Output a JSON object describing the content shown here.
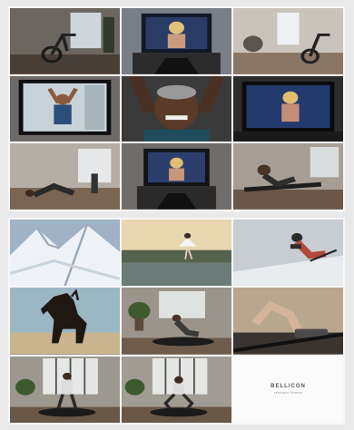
{
  "image_description_free": true,
  "colors": {
    "frame_bg": "#f7f7f7",
    "page_bg": "#e9e9e9"
  },
  "top_board": {
    "tiles": [
      {
        "icon": "bike-in-living-room"
      },
      {
        "icon": "screen-blonde-instructor"
      },
      {
        "icon": "bikes-in-bright-room"
      },
      {
        "icon": "screen-instructor-arms-up"
      },
      {
        "icon": "smiling-man-workout"
      },
      {
        "icon": "screen-blonde-instructor-dark"
      },
      {
        "icon": "person-stretching-on-floor"
      },
      {
        "icon": "screen-blonde-instructor-close"
      },
      {
        "icon": "man-rowing"
      }
    ]
  },
  "bottom_board": {
    "tiles": [
      {
        "icon": "snowy-mountains"
      },
      {
        "icon": "ballerina-at-pool"
      },
      {
        "icon": "skier-jumping"
      },
      {
        "icon": "rearing-horse-silhouette"
      },
      {
        "icon": "woman-on-trampoline-plant-room"
      },
      {
        "icon": "trampoline-feet-closeup"
      },
      {
        "icon": "man-on-trampoline-windows"
      },
      {
        "icon": "man-squat-on-trampoline"
      },
      {
        "icon": "brand-card"
      }
    ],
    "brand": {
      "name": "BELLICON",
      "tagline": "rebound fitness"
    }
  }
}
